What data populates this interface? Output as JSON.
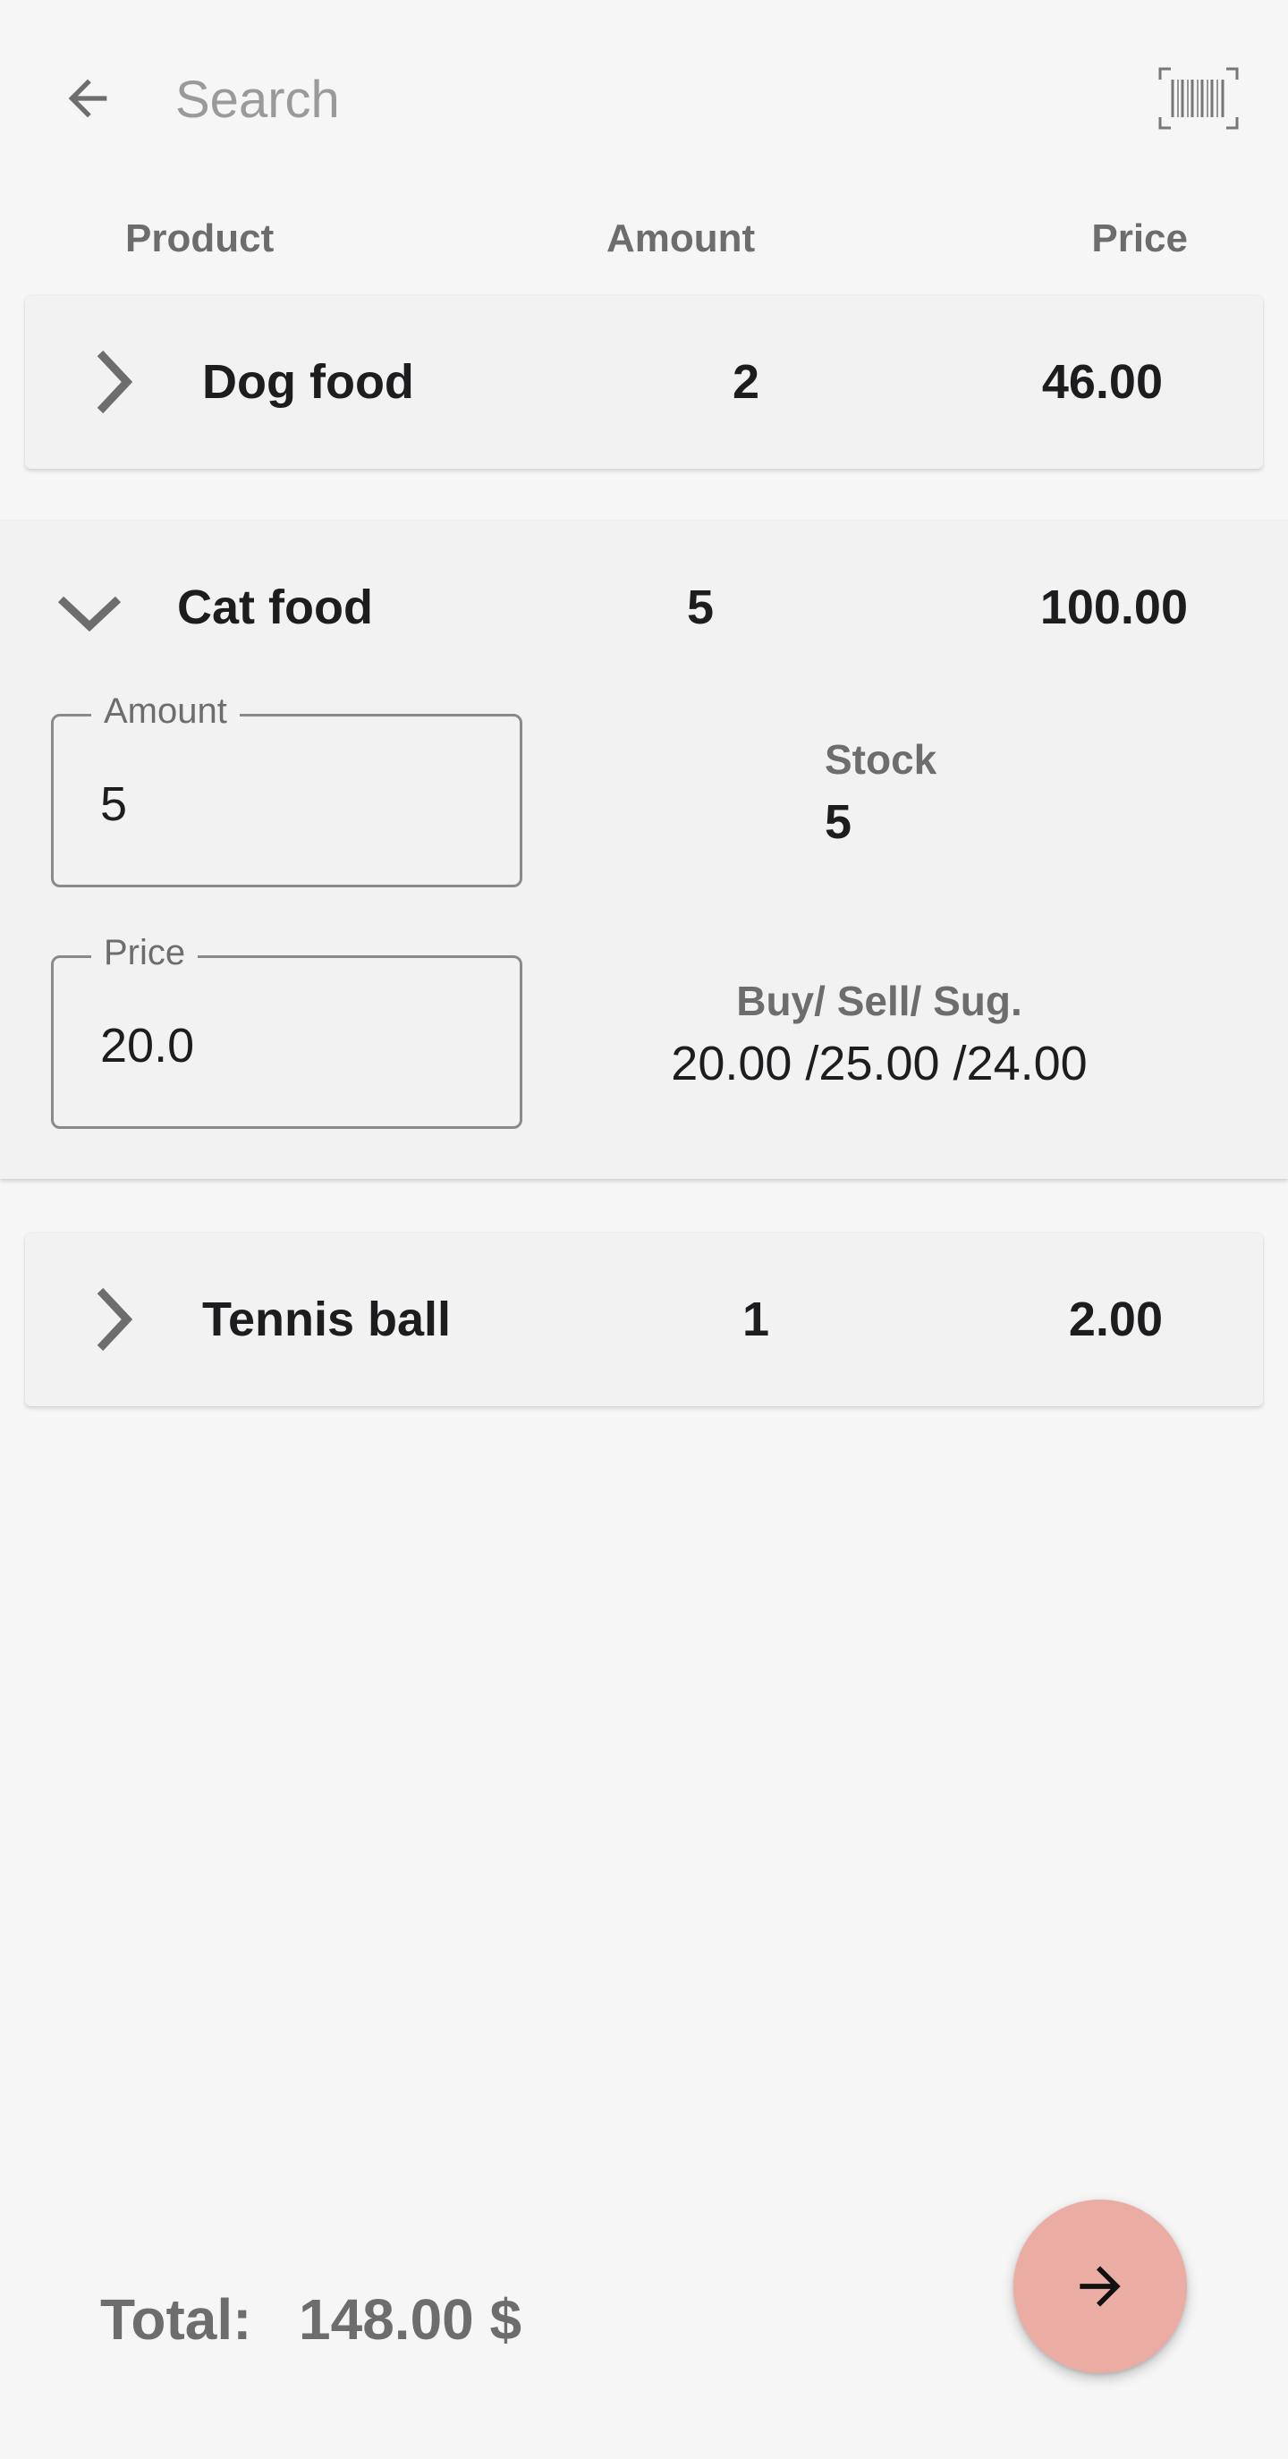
{
  "topbar": {
    "back_icon": "arrow-left-icon",
    "search_placeholder": "Search",
    "search_value": "",
    "barcode_icon": "barcode-scan-icon"
  },
  "columns": {
    "product": "Product",
    "amount": "Amount",
    "price": "Price"
  },
  "items": [
    {
      "name": "Dog food",
      "amount": "2",
      "price": "46.00",
      "expanded": false
    },
    {
      "name": "Cat food",
      "amount": "5",
      "price": "100.00",
      "expanded": true
    },
    {
      "name": "Tennis ball",
      "amount": "1",
      "price": "2.00",
      "expanded": false
    }
  ],
  "detail": {
    "amount_label": "Amount",
    "amount_value": "5",
    "price_label": "Price",
    "price_value": "20.0",
    "stock_label": "Stock",
    "stock_value": "5",
    "bss_label": "Buy/ Sell/ Sug.",
    "bss_value": "20.00 /25.00 /24.00"
  },
  "footer": {
    "total_label": "Total:",
    "total_value": "148.00 $",
    "fab_icon": "arrow-right-icon"
  },
  "colors": {
    "background": "#f6f6f7",
    "card": "#f2f2f3",
    "fab": "#ebaca4"
  }
}
